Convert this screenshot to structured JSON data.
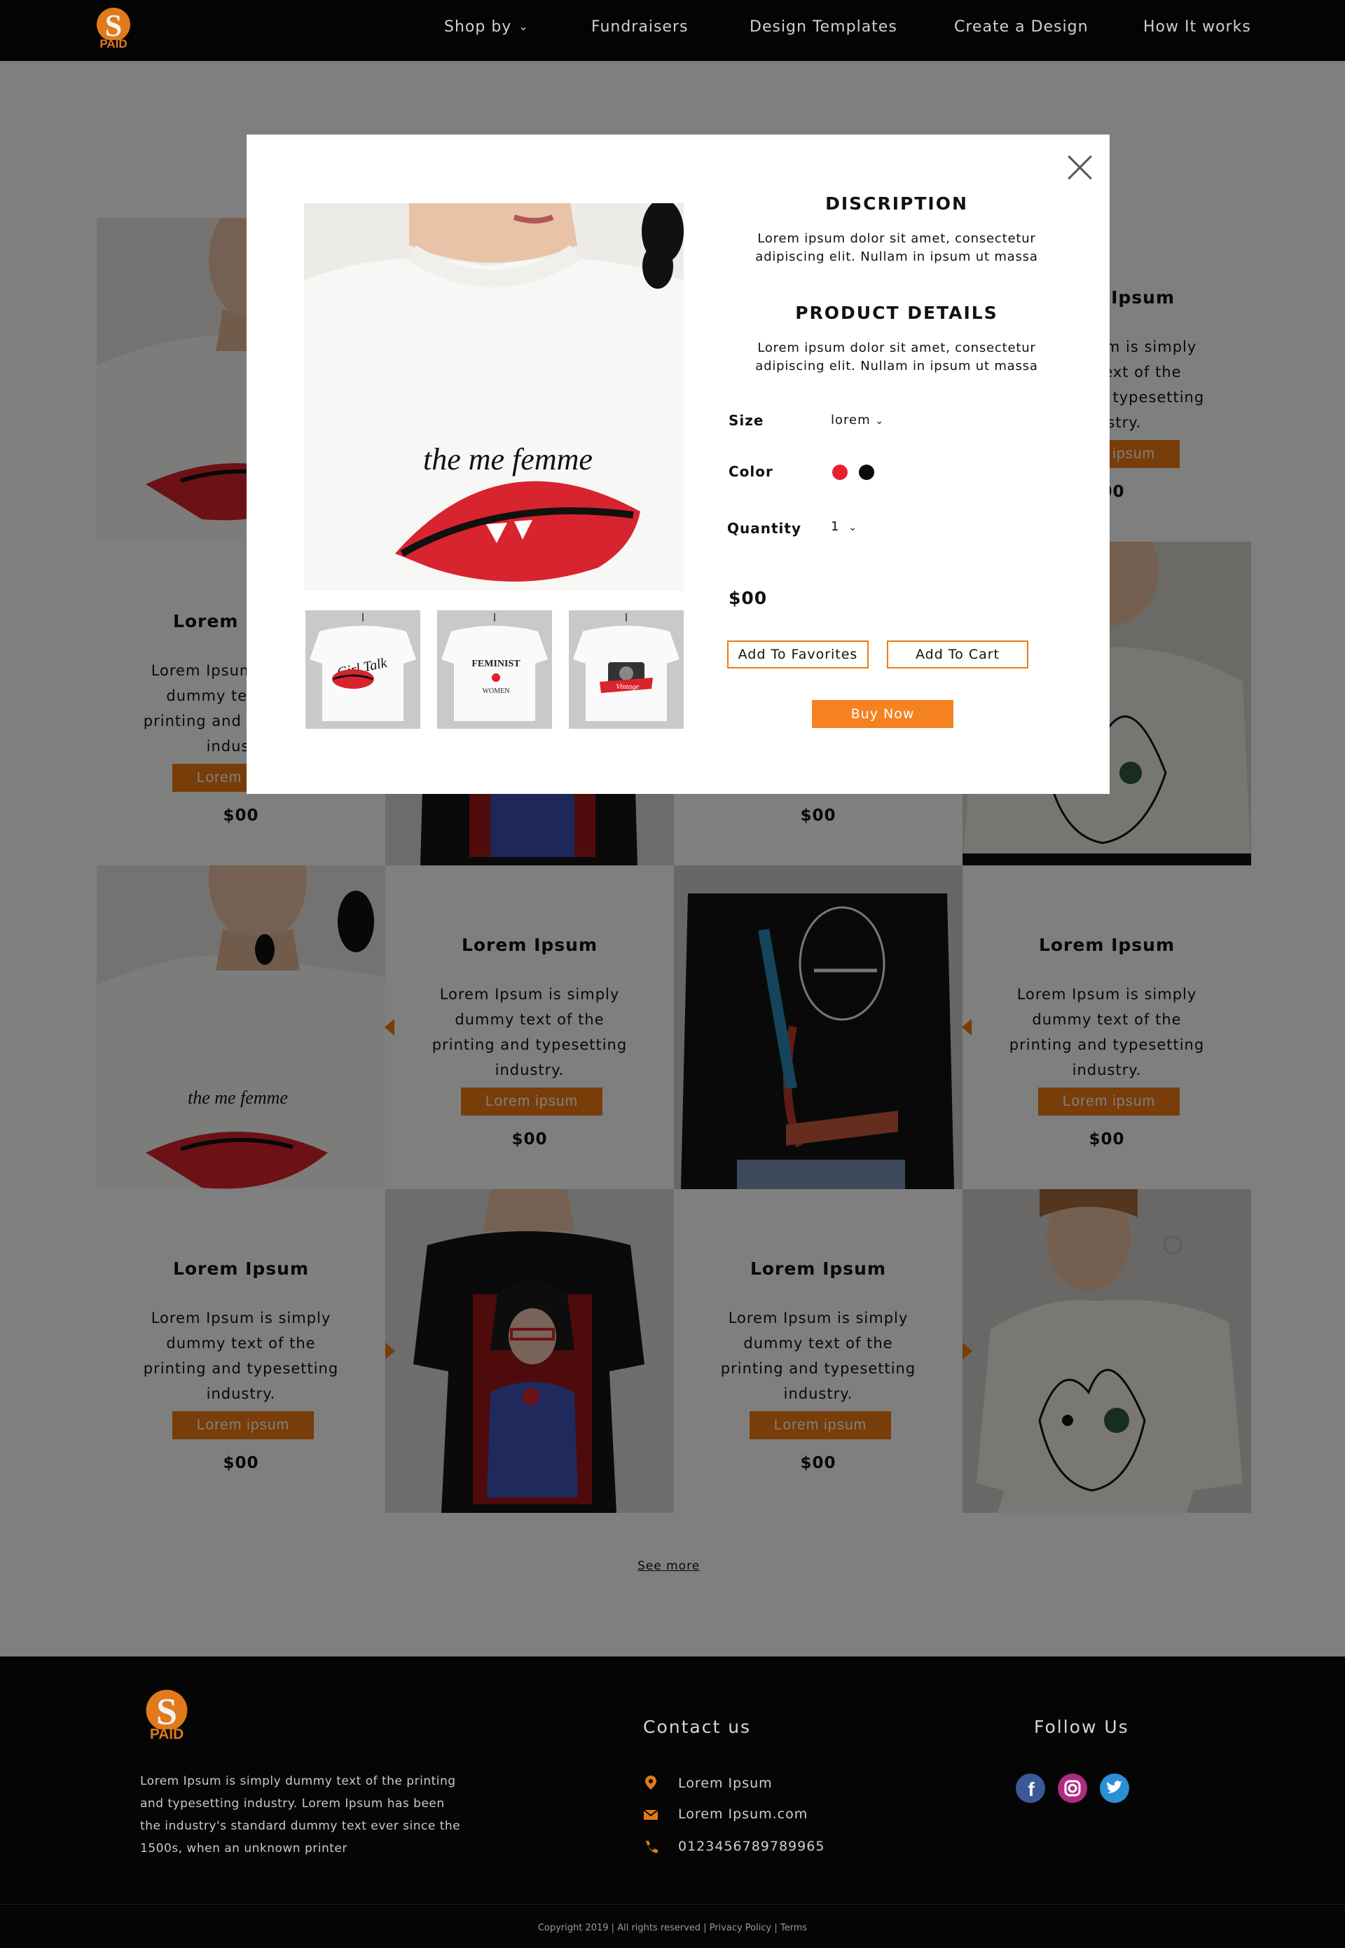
{
  "header": {
    "nav": [
      {
        "label": "Shop by",
        "has_dropdown": true
      },
      {
        "label": "Fundraisers"
      },
      {
        "label": "Design Templates"
      },
      {
        "label": "Create a Design"
      },
      {
        "label": "How It works"
      }
    ]
  },
  "product_card": {
    "title": "Lorem Ipsum",
    "body": "Lorem Ipsum is simply dummy text of the printing and typesetting industry.",
    "button": "Lorem ipsum",
    "price": "$00"
  },
  "see_more": "See more",
  "modal": {
    "description_heading": "DISCRIPTION",
    "description_text": "Lorem ipsum dolor sit amet, consectetur adipiscing elit. Nullam in ipsum ut massa",
    "details_heading": "PRODUCT DETAILS",
    "details_text": "Lorem ipsum dolor sit amet, consectetur adipiscing elit. Nullam in ipsum ut massa",
    "size_label": "Size",
    "size_value": "lorem",
    "color_label": "Color",
    "colors": [
      "#e8202e",
      "#0a0a0a"
    ],
    "quantity_label": "Quantity",
    "quantity_value": "1",
    "price": "$00",
    "add_to_favorites": "Add To Favorites",
    "add_to_cart": "Add To Cart",
    "buy_now": "Buy Now",
    "thumbnails": [
      {
        "text": "Girl Talk"
      },
      {
        "text_top": "FEMINIST",
        "text_bottom": "WOMEN"
      },
      {
        "text": "Vintage"
      }
    ],
    "main_image_text": "the me femme"
  },
  "footer": {
    "about": "Lorem Ipsum is simply dummy text of the printing and typesetting industry. Lorem Ipsum has been the industry's standard dummy text ever since the 1500s, when an unknown printer",
    "contact_heading": "Contact us",
    "contact": {
      "address": "Lorem Ipsum",
      "email": "Lorem Ipsum.com",
      "phone": "0123456789789965"
    },
    "follow_heading": "Follow Us",
    "copyright": "Copyright 2019 | All rights reserved | Privacy Policy | Terms"
  },
  "brand": {
    "accent": "#f07a10",
    "logo_text": "PAID"
  },
  "icons": [
    "chevron-down-icon",
    "close-icon",
    "location-pin-icon",
    "mail-icon",
    "phone-icon",
    "facebook-icon",
    "instagram-icon",
    "twitter-icon"
  ]
}
